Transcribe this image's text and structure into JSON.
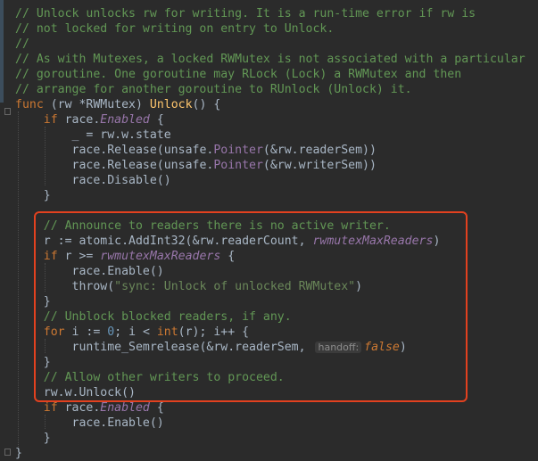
{
  "colors": {
    "background": "#2b2b2b",
    "text": "#a9b7c6",
    "comment": "#629755",
    "keyword": "#cc7832",
    "string": "#6a8759",
    "number": "#6897bb",
    "function": "#ffc66d",
    "field": "#9876aa",
    "highlight_box": "#e2411f"
  },
  "code": {
    "c1": "// Unlock unlocks rw for writing. It is a run-time error if rw is",
    "c2": "// not locked for writing on entry to Unlock.",
    "c3": "//",
    "c4": "// As with Mutexes, a locked RWMutex is not associated with a particular",
    "c5": "// goroutine. One goroutine may RLock (Lock) a RWMutex and then",
    "c6": "// arrange for another goroutine to RUnlock (Unlock) it.",
    "func_kw": "func",
    "recv_open": " (rw *",
    "recv_type": "RWMutex",
    "recv_close": ") ",
    "func_name": "Unlock",
    "func_tail": "() {",
    "if_kw": "if",
    "race_prefix": " race.",
    "enabled": "Enabled",
    "brace_open": " {",
    "l9": "_ = rw.w.state",
    "rel_prefix": "race.Release(unsafe.",
    "pointer": "Pointer",
    "rel_reader_tail": "(&rw.readerSem))",
    "rel_writer_tail": "(&rw.writerSem))",
    "l12": "race.Disable()",
    "close_brace": "}",
    "c_announce": "// Announce to readers there is no active writer.",
    "add_prefix": "r := atomic.AddInt32(&rw.readerCount, ",
    "max_readers": "rwmutexMaxReaders",
    "add_suffix": ")",
    "if_r_cond": " r >= ",
    "l19": "race.Enable()",
    "throw_fn": "throw(",
    "throw_msg": "\"sync: Unlock of unlocked RWMutex\"",
    "throw_close": ")",
    "c_unblock": "// Unblock blocked readers, if any.",
    "for_kw": "for",
    "for_mid1": " i := ",
    "zero": "0",
    "for_mid2": "; i < ",
    "int_kw": "int",
    "for_tail": "(r); i++ {",
    "sem_prefix": "runtime_Semrelease(&rw.readerSem, ",
    "handoff_hint": "handoff:",
    "false_kw": "false",
    "sem_suffix": ")",
    "c_allow": "// Allow other writers to proceed.",
    "unlock_call": "rw.w.Unlock()",
    "l30": "race.Enable()"
  }
}
